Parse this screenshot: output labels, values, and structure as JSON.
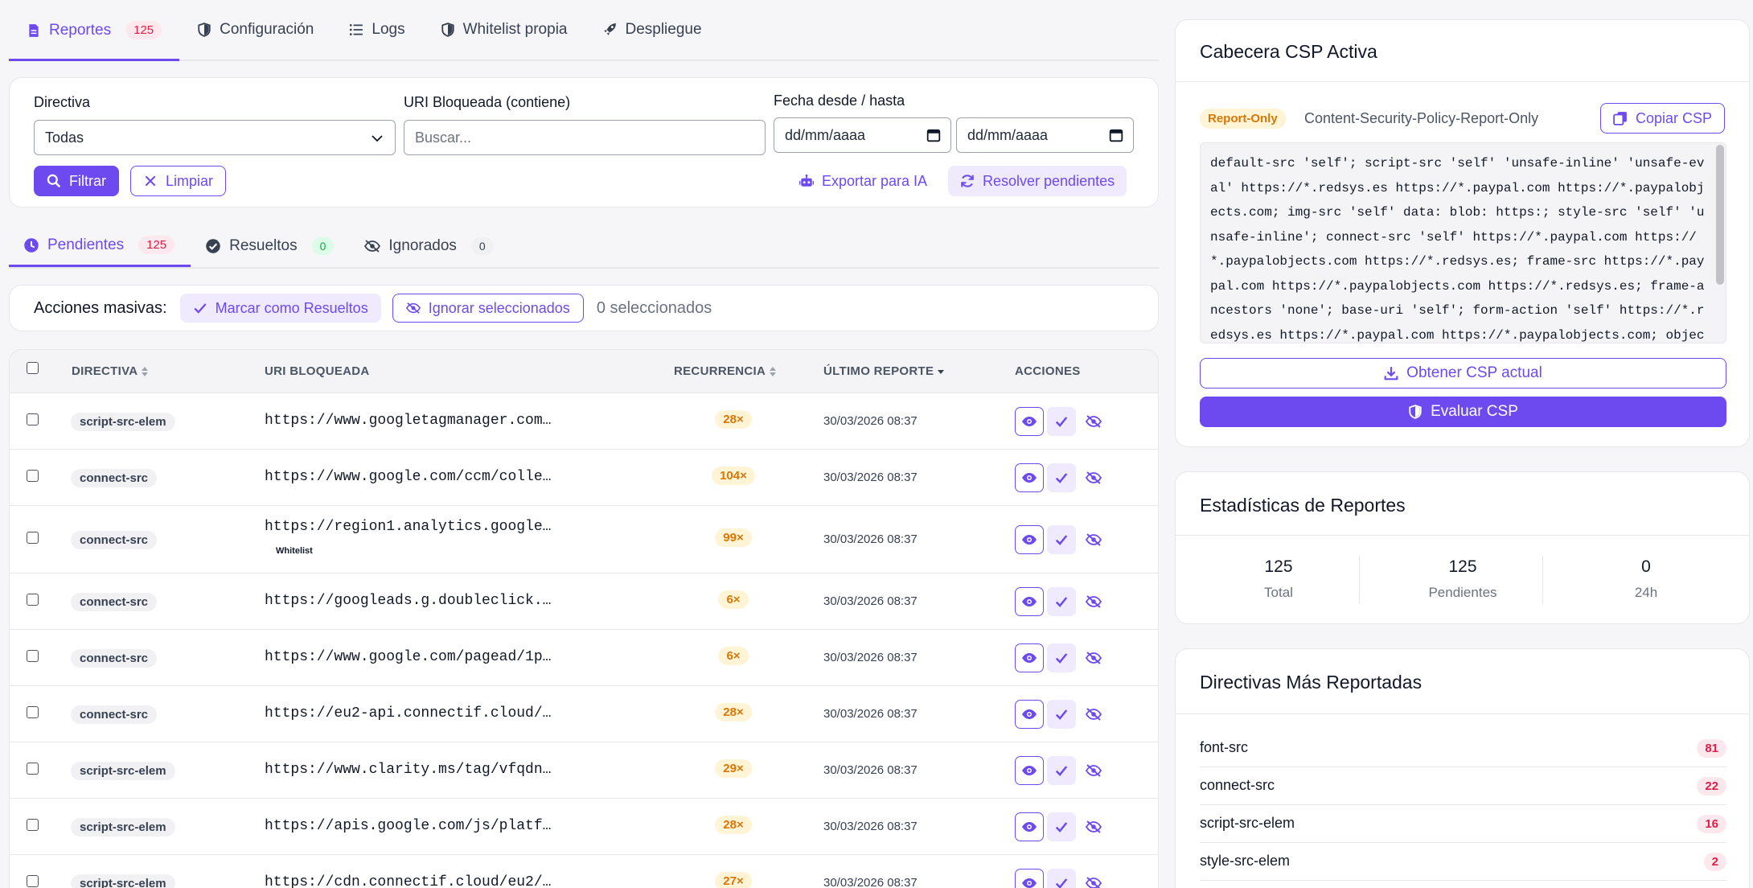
{
  "main_tabs": [
    {
      "label": "Reportes",
      "badge": "125",
      "icon": "file-icon"
    },
    {
      "label": "Configuración",
      "icon": "shield-icon"
    },
    {
      "label": "Logs",
      "icon": "list-icon"
    },
    {
      "label": "Whitelist propia",
      "icon": "shield-icon"
    },
    {
      "label": "Despliegue",
      "icon": "rocket-icon"
    }
  ],
  "filters": {
    "directiva_label": "Directiva",
    "directiva_value": "Todas",
    "uri_label": "URI Bloqueada (contiene)",
    "uri_placeholder": "Buscar...",
    "fecha_label": "Fecha desde / hasta",
    "fecha_desde_placeholder": "dd/mm/aaaa",
    "fecha_hasta_placeholder": "dd/mm/aaaa",
    "filtrar": "Filtrar",
    "limpiar": "Limpiar",
    "exportar": "Exportar para IA",
    "resolver": "Resolver pendientes"
  },
  "status_tabs": [
    {
      "label": "Pendientes",
      "count": "125"
    },
    {
      "label": "Resueltos",
      "count": "0"
    },
    {
      "label": "Ignorados",
      "count": "0"
    }
  ],
  "bulk": {
    "title": "Acciones masivas:",
    "mark_resolved": "Marcar como Resueltos",
    "ignore_selected": "Ignorar seleccionados",
    "selected_count": "0 seleccionados"
  },
  "table": {
    "headers": {
      "directiva": "DIRECTIVA",
      "uri": "URI BLOQUEADA",
      "recurrencia": "RECURRENCIA",
      "ultimo": "ÚLTIMO REPORTE",
      "acciones": "ACCIONES"
    },
    "rows": [
      {
        "directiva": "script-src-elem",
        "uri": "https://www.googletagmanager.com…",
        "recurrencia": "28×",
        "fecha": "30/03/2026 08:37"
      },
      {
        "directiva": "connect-src",
        "uri": "https://www.google.com/ccm/colle…",
        "recurrencia": "104×",
        "fecha": "30/03/2026 08:37"
      },
      {
        "directiva": "connect-src",
        "uri": "https://region1.analytics.google…",
        "tag": "Whitelist",
        "recurrencia": "99×",
        "fecha": "30/03/2026 08:37"
      },
      {
        "directiva": "connect-src",
        "uri": "https://googleads.g.doubleclick.…",
        "recurrencia": "6×",
        "fecha": "30/03/2026 08:37"
      },
      {
        "directiva": "connect-src",
        "uri": "https://www.google.com/pagead/1p…",
        "recurrencia": "6×",
        "fecha": "30/03/2026 08:37"
      },
      {
        "directiva": "connect-src",
        "uri": "https://eu2-api.connectif.cloud/…",
        "recurrencia": "28×",
        "fecha": "30/03/2026 08:37"
      },
      {
        "directiva": "script-src-elem",
        "uri": "https://www.clarity.ms/tag/vfqdn…",
        "recurrencia": "29×",
        "fecha": "30/03/2026 08:37"
      },
      {
        "directiva": "script-src-elem",
        "uri": "https://apis.google.com/js/platf…",
        "recurrencia": "28×",
        "fecha": "30/03/2026 08:37"
      },
      {
        "directiva": "script-src-elem",
        "uri": "https://cdn.connectif.cloud/eu2/…",
        "recurrencia": "27×",
        "fecha": "30/03/2026 08:37"
      }
    ]
  },
  "csp": {
    "title": "Cabecera CSP Activa",
    "mode_badge": "Report-Only",
    "header_name": "Content-Security-Policy-Report-Only",
    "copy_label": "Copiar CSP",
    "policy": "default-src 'self'; script-src 'self' 'unsafe-inline' 'unsafe-eval' https://*.redsys.es https://*.paypal.com https://*.paypalobjects.com; img-src 'self' data: blob: https:; style-src 'self' 'unsafe-inline'; connect-src 'self' https://*.paypal.com https://*.paypalobjects.com https://*.redsys.es; frame-src https://*.paypal.com https://*.paypalobjects.com https://*.redsys.es; frame-ancestors 'none'; base-uri 'self'; form-action 'self' https://*.redsys.es https://*.paypal.com https://*.paypalobjects.com; object-src 'none'; upgrade-insecure-r",
    "get_label": "Obtener CSP actual",
    "eval_label": "Evaluar CSP"
  },
  "stats": {
    "title": "Estadísticas de Reportes",
    "items": [
      {
        "value": "125",
        "label": "Total"
      },
      {
        "value": "125",
        "label": "Pendientes"
      },
      {
        "value": "0",
        "label": "24h"
      }
    ]
  },
  "top_directives": {
    "title": "Directivas Más Reportadas",
    "items": [
      {
        "name": "font-src",
        "count": "81"
      },
      {
        "name": "connect-src",
        "count": "22"
      },
      {
        "name": "script-src-elem",
        "count": "16"
      },
      {
        "name": "style-src-elem",
        "count": "2"
      }
    ]
  },
  "colors": {
    "accent": "#6d4aef",
    "danger": "#e11d48",
    "warning": "#d97706",
    "success": "#16a34a"
  }
}
